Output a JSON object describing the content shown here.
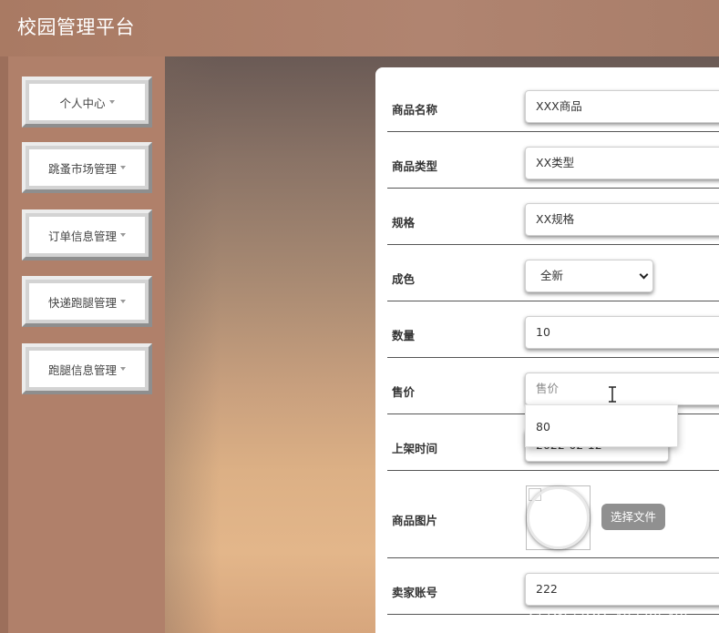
{
  "app": {
    "title": "校园管理平台"
  },
  "sidebar": {
    "items": [
      {
        "label": "个人中心"
      },
      {
        "label": "跳蚤市场管理"
      },
      {
        "label": "订单信息管理"
      },
      {
        "label": "快递跑腿管理"
      },
      {
        "label": "跑腿信息管理"
      }
    ]
  },
  "form": {
    "fields": [
      {
        "label": "商品名称",
        "value": "XXX商品"
      },
      {
        "label": "商品类型",
        "value": "XX类型"
      },
      {
        "label": "规格",
        "value": "XX规格"
      },
      {
        "label": "成色",
        "value": "全新"
      },
      {
        "label": "数量",
        "value": "10"
      },
      {
        "label": "售价",
        "placeholder": "售价"
      },
      {
        "label": "上架时间",
        "value": "2022-02-12"
      },
      {
        "label": "商品图片"
      },
      {
        "label": "卖家账号",
        "value": "222"
      }
    ],
    "autocomplete_option": "80",
    "file_button_label": "选择文件"
  },
  "watermark": "CSDN @QQ_402205496"
}
